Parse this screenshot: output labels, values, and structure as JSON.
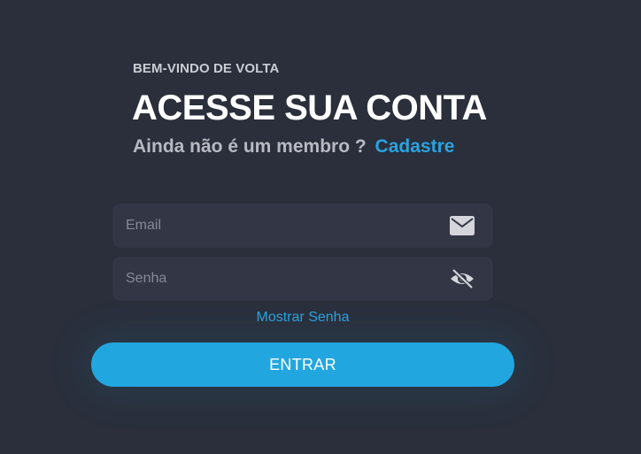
{
  "header": {
    "welcome": "BEM-VINDO DE VOLTA",
    "title": "ACESSE SUA CONTA",
    "subtitle_prefix": "Ainda não é um membro ?",
    "signup_link": "Cadastre"
  },
  "form": {
    "email_placeholder": "Email",
    "email_value": "",
    "email_icon": "envelope-icon",
    "password_placeholder": "Senha",
    "password_value": "",
    "password_icon": "eye-slash-icon",
    "show_password": "Mostrar Senha",
    "submit": "ENTRAR"
  },
  "colors": {
    "background": "#2a2f3b",
    "input_background": "#333645",
    "accent": "#22a6df",
    "link": "#2ba3e0"
  }
}
